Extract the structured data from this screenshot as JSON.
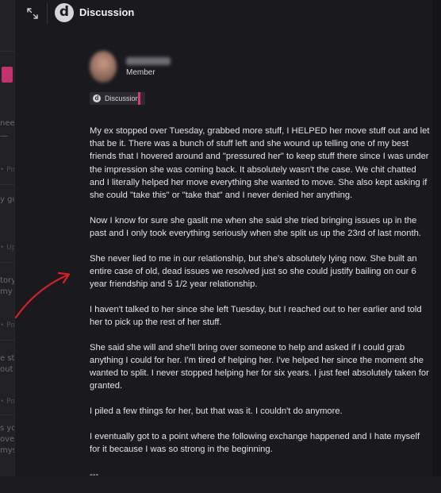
{
  "background": {
    "fragments": [
      "need",
      "—",
      "• Po",
      "y guy",
      "• Up",
      "tory",
      "my",
      "• Po",
      "e st",
      "out",
      "• Po",
      "s you",
      "over",
      "myse"
    ]
  },
  "header": {
    "logo_letter": "d",
    "title": "Discussion"
  },
  "post": {
    "author_role": "Member",
    "tag": {
      "logo_letter": "d",
      "label": "Discussion",
      "accent_color": "#e0337a"
    },
    "paragraphs": [
      "My ex stopped over Tuesday, grabbed more stuff, I HELPED her move stuff out and let that be it. There was a bunch of stuff left and she wound up telling one of my best friends that I hovered around and \"pressured her\" to keep stuff there since I was under the impression she was coming back. It absolutely wasn't the case. We chit chatted and I literally helped her move everything she wanted to move. She also kept asking if she could \"take this\" or \"take that\" and I never denied her anything.",
      "Now I know for sure she gaslit me when she said she tried bringing issues up in the past and I only took everything seriously when she split us up the 23rd of last month.",
      "She never lied to me in our relationship, but she's absolutely lying now. She built an entire case of old, dead issues we resolved just so she could justify bailing on our 6 year friendship and 5 1/2 year relationship.",
      "I haven't talked to her since she left Tuesday, but I reached out to her earlier and told her to pick up the rest of her stuff.",
      "She said she will and she'll bring over someone to help and asked if I could grab anything I could for her. I'm tired of helping her. I've helped her since the moment she wanted to split. I never stopped helping her for six years. I just feel absolutely taken for granted.",
      "I piled a few things for her, but that was it. I couldn't do anymore.",
      "I eventually got to a point where the following exchange happened and I hate myself for it because I was so strong in the beginning.",
      "---"
    ]
  },
  "colors": {
    "annotation_arrow": "#d3202a",
    "accent": "#e0337a"
  }
}
